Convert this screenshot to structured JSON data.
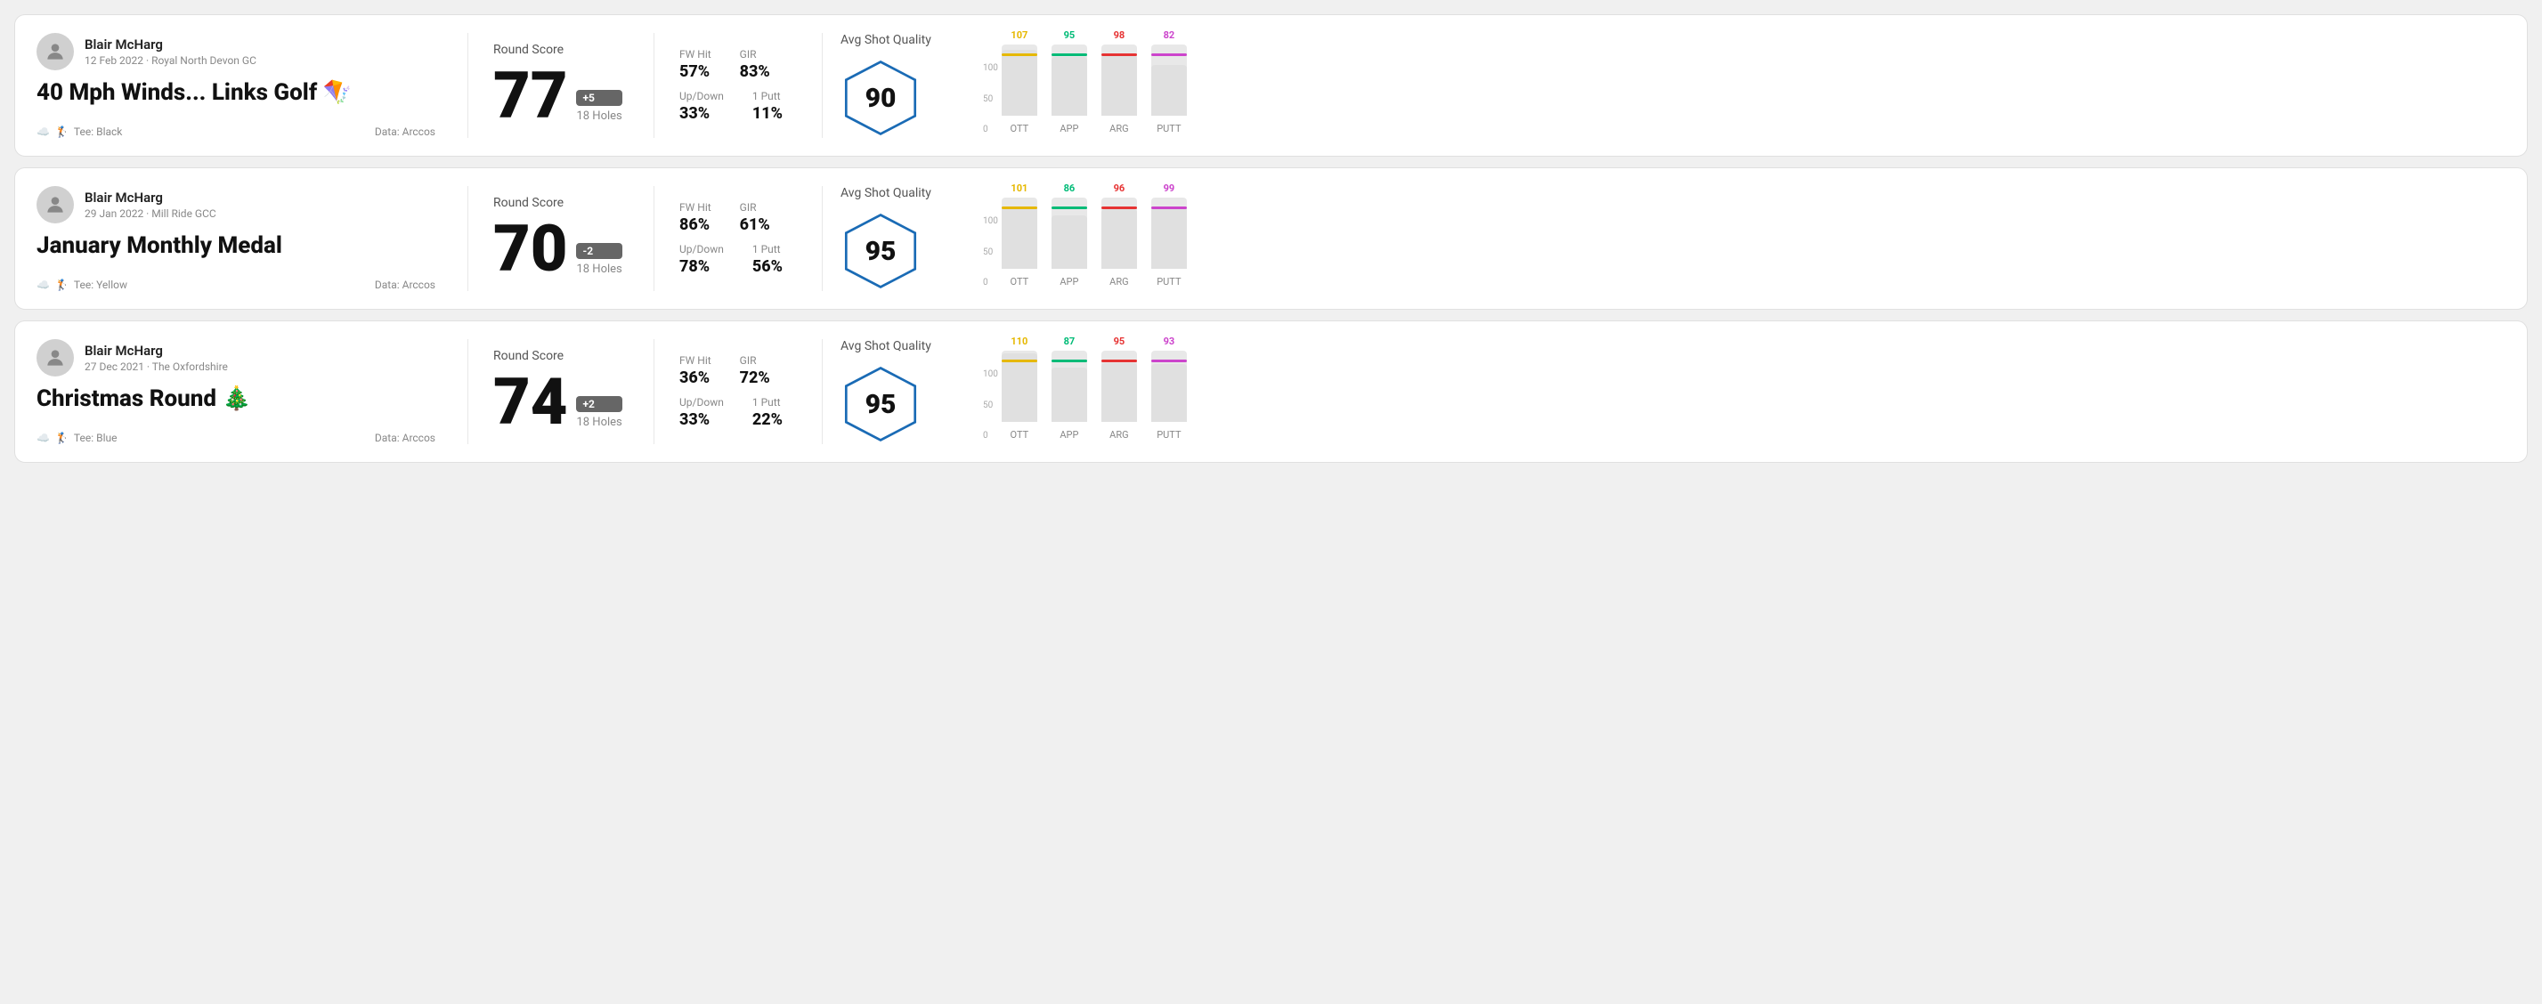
{
  "cards": [
    {
      "id": "card1",
      "user": {
        "name": "Blair McHarg",
        "meta": "12 Feb 2022 · Royal North Devon GC"
      },
      "title": "40 Mph Winds... Links Golf 🪁",
      "tee": "Black",
      "data_source": "Arccos",
      "score": 77,
      "score_diff": "+5",
      "score_diff_sign": "positive",
      "holes": "18 Holes",
      "fw_hit": "57%",
      "gir": "83%",
      "up_down": "33%",
      "one_putt": "11%",
      "avg_quality": 90,
      "chart": {
        "bars": [
          {
            "label": "OTT",
            "value": 107,
            "color": "#e6b800"
          },
          {
            "label": "APP",
            "value": 95,
            "color": "#00bb77"
          },
          {
            "label": "ARG",
            "value": 98,
            "color": "#e63333"
          },
          {
            "label": "PUTT",
            "value": 82,
            "color": "#cc44cc"
          }
        ]
      }
    },
    {
      "id": "card2",
      "user": {
        "name": "Blair McHarg",
        "meta": "29 Jan 2022 · Mill Ride GCC"
      },
      "title": "January Monthly Medal",
      "tee": "Yellow",
      "data_source": "Arccos",
      "score": 70,
      "score_diff": "-2",
      "score_diff_sign": "negative",
      "holes": "18 Holes",
      "fw_hit": "86%",
      "gir": "61%",
      "up_down": "78%",
      "one_putt": "56%",
      "avg_quality": 95,
      "chart": {
        "bars": [
          {
            "label": "OTT",
            "value": 101,
            "color": "#e6b800"
          },
          {
            "label": "APP",
            "value": 86,
            "color": "#00bb77"
          },
          {
            "label": "ARG",
            "value": 96,
            "color": "#e63333"
          },
          {
            "label": "PUTT",
            "value": 99,
            "color": "#cc44cc"
          }
        ]
      }
    },
    {
      "id": "card3",
      "user": {
        "name": "Blair McHarg",
        "meta": "27 Dec 2021 · The Oxfordshire"
      },
      "title": "Christmas Round 🎄",
      "tee": "Blue",
      "data_source": "Arccos",
      "score": 74,
      "score_diff": "+2",
      "score_diff_sign": "positive",
      "holes": "18 Holes",
      "fw_hit": "36%",
      "gir": "72%",
      "up_down": "33%",
      "one_putt": "22%",
      "avg_quality": 95,
      "chart": {
        "bars": [
          {
            "label": "OTT",
            "value": 110,
            "color": "#e6b800"
          },
          {
            "label": "APP",
            "value": 87,
            "color": "#00bb77"
          },
          {
            "label": "ARG",
            "value": 95,
            "color": "#e63333"
          },
          {
            "label": "PUTT",
            "value": 93,
            "color": "#cc44cc"
          }
        ]
      }
    }
  ],
  "labels": {
    "round_score": "Round Score",
    "avg_shot_quality": "Avg Shot Quality",
    "fw_hit": "FW Hit",
    "gir": "GIR",
    "up_down": "Up/Down",
    "one_putt": "1 Putt",
    "tee_prefix": "Tee:",
    "data_prefix": "Data:"
  }
}
